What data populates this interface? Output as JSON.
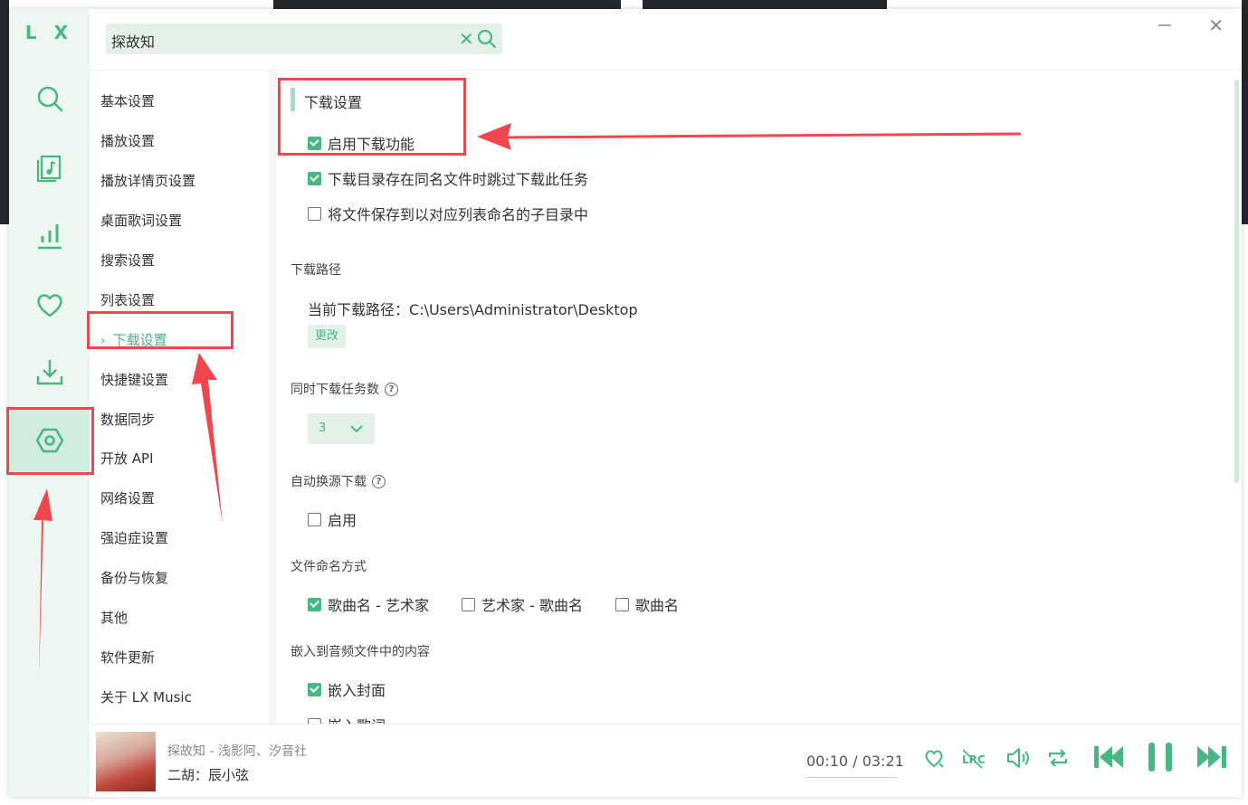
{
  "app": {
    "logo": "L X"
  },
  "search": {
    "value": "探故知"
  },
  "settings_menu": {
    "items": [
      {
        "label": "基本设置"
      },
      {
        "label": "播放设置"
      },
      {
        "label": "播放详情页设置"
      },
      {
        "label": "桌面歌词设置"
      },
      {
        "label": "搜索设置"
      },
      {
        "label": "列表设置"
      },
      {
        "label": "下载设置",
        "active": true
      },
      {
        "label": "快捷键设置"
      },
      {
        "label": "数据同步"
      },
      {
        "label": "开放 API"
      },
      {
        "label": "网络设置"
      },
      {
        "label": "强迫症设置"
      },
      {
        "label": "备份与恢复"
      },
      {
        "label": "其他"
      },
      {
        "label": "软件更新"
      },
      {
        "label": "关于 LX Music"
      }
    ]
  },
  "download": {
    "title": "下载设置",
    "enable": {
      "label": "启用下载功能",
      "checked": true
    },
    "skip_existing": {
      "label": "下载目录存在同名文件时跳过下载此任务",
      "checked": true
    },
    "save_to_subdir": {
      "label": "将文件保存到以对应列表命名的子目录中",
      "checked": false
    },
    "path_section": "下载路径",
    "path_prefix": "当前下载路径：",
    "path_value": "C:\\Users\\Administrator\\Desktop",
    "change_button": "更改",
    "concurrent_section": "同时下载任务数",
    "concurrent_value": "3",
    "auto_switch_section": "自动换源下载",
    "auto_switch_enable": {
      "label": "启用",
      "checked": false
    },
    "naming_section": "文件命名方式",
    "naming_options": [
      {
        "label": "歌曲名 - 艺术家",
        "checked": true
      },
      {
        "label": "艺术家 - 歌曲名",
        "checked": false
      },
      {
        "label": "歌曲名",
        "checked": false
      }
    ],
    "embed_section": "嵌入到音频文件中的内容",
    "embed_cover": {
      "label": "嵌入封面",
      "checked": true
    },
    "embed_lyrics": {
      "label": "嵌入歌词",
      "checked": false
    }
  },
  "player": {
    "title": "探故知 - 浅影阿、汐音社",
    "lyric": "二胡：辰小弦",
    "current_time": "00:10",
    "separator": "/",
    "duration": "03:21"
  },
  "colors": {
    "accent": "#47b784",
    "annotation": "#f0474f"
  }
}
